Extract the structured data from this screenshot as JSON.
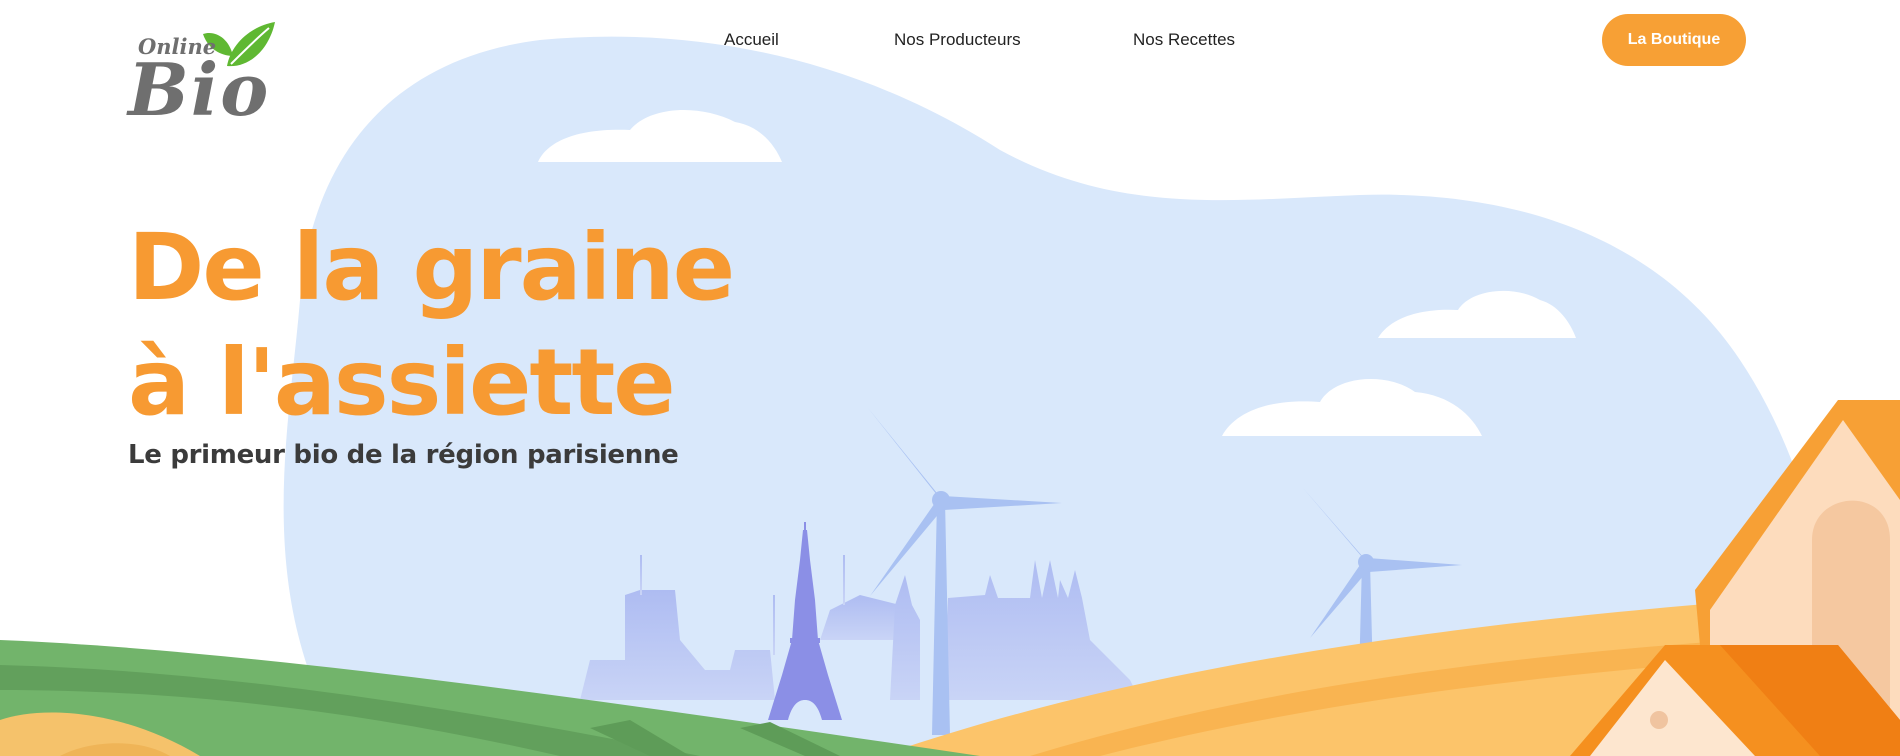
{
  "header": {
    "logo": {
      "line1": "Online",
      "line2": "Bio"
    },
    "nav": [
      {
        "label": "Accueil"
      },
      {
        "label": "Nos Producteurs"
      },
      {
        "label": "Nos Recettes"
      }
    ],
    "cta_label": "La Boutique"
  },
  "hero": {
    "title_line1": "De la graine",
    "title_line2": "à l'assiette",
    "subtitle": "Le primeur bio de la région parisienne"
  },
  "colors": {
    "accent_orange": "#f7a035",
    "title_orange": "#f79a32",
    "sky_blue": "#d9e8fb",
    "logo_grey": "#6f6f6f",
    "leaf_green": "#5fb832"
  }
}
